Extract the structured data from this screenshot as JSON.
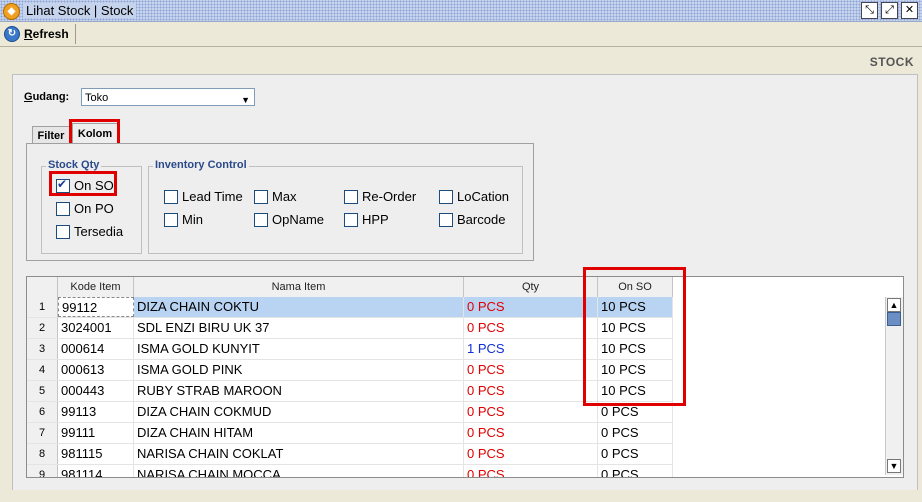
{
  "window": {
    "title": "Lihat Stock | Stock",
    "icon": "app-logo-icon",
    "buttons": [
      "restore-icon",
      "maximize-icon",
      "close-icon"
    ]
  },
  "toolbar": {
    "refresh_label_first": "R",
    "refresh_label_rest": "efresh",
    "refresh_icon": "refresh-icon"
  },
  "header": {
    "section_label": "STOCK"
  },
  "gudang": {
    "label": "Gudang:",
    "value": "Toko"
  },
  "tabs": [
    {
      "label": "Filter",
      "active": false
    },
    {
      "label": "Kolom",
      "active": true
    }
  ],
  "stock_qty": {
    "title": "Stock Qty",
    "options": [
      {
        "label": "On SO",
        "checked": true
      },
      {
        "label": "On PO",
        "checked": false
      },
      {
        "label": "Tersedia",
        "checked": false
      }
    ]
  },
  "inventory_control": {
    "title": "Inventory Control",
    "options": [
      {
        "label": "Lead Time",
        "checked": false
      },
      {
        "label": "Max",
        "checked": false
      },
      {
        "label": "Re-Order",
        "checked": false
      },
      {
        "label": "LoCation",
        "checked": false
      },
      {
        "label": "Min",
        "checked": false
      },
      {
        "label": "OpName",
        "checked": false
      },
      {
        "label": "HPP",
        "checked": false
      },
      {
        "label": "Barcode",
        "checked": false
      }
    ]
  },
  "grid": {
    "columns": [
      "",
      "Kode Item",
      "Nama Item",
      "Qty",
      "On SO"
    ],
    "rows": [
      {
        "no": "1",
        "kode": "99112",
        "nama": "DIZA CHAIN COKTU",
        "qty": "0 PCS",
        "onso": "10 PCS",
        "qty_color": "red",
        "selected": true
      },
      {
        "no": "2",
        "kode": "3024001",
        "nama": "SDL ENZI BIRU UK 37",
        "qty": "0 PCS",
        "onso": "10 PCS",
        "qty_color": "red"
      },
      {
        "no": "3",
        "kode": "000614",
        "nama": "ISMA GOLD KUNYIT",
        "qty": "1 PCS",
        "onso": "10 PCS",
        "qty_color": "blue"
      },
      {
        "no": "4",
        "kode": "000613",
        "nama": "ISMA GOLD PINK",
        "qty": "0 PCS",
        "onso": "10 PCS",
        "qty_color": "red"
      },
      {
        "no": "5",
        "kode": "000443",
        "nama": "RUBY STRAB MAROON",
        "qty": "0 PCS",
        "onso": "10 PCS",
        "qty_color": "red"
      },
      {
        "no": "6",
        "kode": "99113",
        "nama": "DIZA CHAIN COKMUD",
        "qty": "0 PCS",
        "onso": "0 PCS",
        "qty_color": "red"
      },
      {
        "no": "7",
        "kode": "99111",
        "nama": "DIZA CHAIN HITAM",
        "qty": "0 PCS",
        "onso": "0 PCS",
        "qty_color": "red"
      },
      {
        "no": "8",
        "kode": "981115",
        "nama": "NARISA CHAIN COKLAT",
        "qty": "0 PCS",
        "onso": "0 PCS",
        "qty_color": "red"
      },
      {
        "no": "9",
        "kode": "981114",
        "nama": "NARISA CHAIN MOCCA",
        "qty": "0 PCS",
        "onso": "0 PCS",
        "qty_color": "red"
      }
    ]
  },
  "colors": {
    "highlight_box": "#e00000",
    "selected_row": "#b9d3f2",
    "qty_red": "#e00000",
    "qty_blue": "#1030d0"
  }
}
